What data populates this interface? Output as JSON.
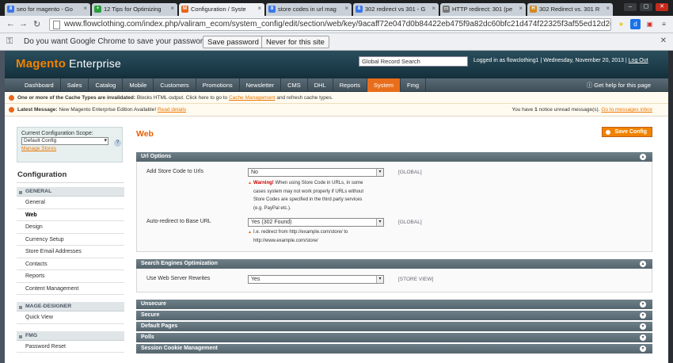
{
  "browser": {
    "tabs": [
      {
        "title": "seo for magento - Go",
        "fav": "8",
        "fav_color": "#3b78e7",
        "active": false
      },
      {
        "title": "12 Tips for Optimizing",
        "fav": "+",
        "fav_color": "#2a9d3a",
        "active": false
      },
      {
        "title": "Configuration / Syste",
        "fav": "M",
        "fav_color": "#e8661a",
        "active": true
      },
      {
        "title": "store codes in url mag",
        "fav": "8",
        "fav_color": "#3b78e7",
        "active": false
      },
      {
        "title": "302 redirect vs 301 - G",
        "fav": "8",
        "fav_color": "#3b78e7",
        "active": false
      },
      {
        "title": "HTTP redirect: 301 (pe",
        "fav": "▭",
        "fav_color": "#777777",
        "active": false
      },
      {
        "title": "302 Redirect vs. 301 R",
        "fav": "H",
        "fav_color": "#d28a1e",
        "active": false
      }
    ],
    "url": "www.flowclothing.com/index.php/valiram_ecom/system_config/edit/section/web/key/9acaff72e047d0b84422eb475f9a82dc60bfc21d474f22325f3af55ed12d2c5",
    "password_prompt": "Do you want Google Chrome to save your password?",
    "save_password": "Save password",
    "never_save": "Never for this site"
  },
  "header": {
    "logo_brand": "Magento",
    "logo_edition": "Enterprise",
    "global_search": "Global Record Search",
    "logged_in": "Logged in as flowclothing1",
    "date": "Wednesday, November 20, 2013",
    "logout": "Log Out"
  },
  "menu": [
    "Dashboard",
    "Sales",
    "Catalog",
    "Mobile",
    "Customers",
    "Promotions",
    "Newsletter",
    "CMS",
    "DHL",
    "Reports",
    "System",
    "Fmg"
  ],
  "menu_active": "System",
  "help": "Get help for this page",
  "notices": {
    "cache_bold": "One or more of the Cache Types are invalidated:",
    "cache_text": "Blocks HTML output. Click here to go to",
    "cache_link": "Cache Management",
    "cache_tail": "and refresh cache types.",
    "latest_bold": "Latest Message:",
    "latest_text": "New Magento Enterprise Edition Available!",
    "latest_link": "Read details",
    "unread_pre": "You have",
    "unread_count": "1",
    "unread_post": "notice unread message(s).",
    "unread_link": "Go to messages inbox"
  },
  "sidebar": {
    "scope_label": "Current Configuration Scope:",
    "scope_value": "Default Config",
    "manage_stores": "Manage Stores",
    "title": "Configuration",
    "groups": [
      {
        "label": "GENERAL",
        "items": [
          "General",
          "Web",
          "Design",
          "Currency Setup",
          "Store Email Addresses",
          "Contacts",
          "Reports",
          "Content Management"
        ]
      },
      {
        "label": "MAGE-DESIGNER",
        "items": [
          "Quick View"
        ]
      },
      {
        "label": "FMG",
        "items": [
          "Password Reset"
        ]
      }
    ],
    "active_item": "Web"
  },
  "main": {
    "title": "Web",
    "save_button": "Save Config",
    "url_options": {
      "header": "Url Options",
      "add_store_code_label": "Add Store Code to Urls",
      "add_store_code_value": "No",
      "add_store_code_scope": "[GLOBAL]",
      "warning_bold": "Warning!",
      "warning_text": [
        "When using Store Code in URLs, in some",
        "cases system may not work properly if URLs without",
        "Store Codes are specified in the third party services",
        "(e.g. PayPal etc.)."
      ],
      "auto_redirect_label": "Auto-redirect to Base URL",
      "auto_redirect_value": "Yes (302 Found)",
      "auto_redirect_scope": "[GLOBAL]",
      "auto_redirect_note": [
        "I.e. redirect from http://example.com/store/ to",
        "http://www.example.com/store/"
      ]
    },
    "seo": {
      "header": "Search Engines Optimization",
      "rewrites_label": "Use Web Server Rewrites",
      "rewrites_value": "Yes",
      "rewrites_scope": "[STORE VIEW]"
    },
    "collapsed_sections": [
      "Unsecure",
      "Secure",
      "Default Pages",
      "Polls",
      "Session Cookie Management"
    ]
  }
}
